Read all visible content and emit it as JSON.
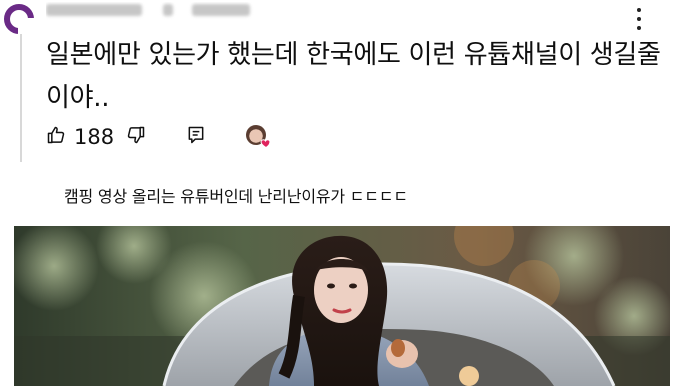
{
  "comment": {
    "text": "일본에만 있는가 했는데 한국에도 이런 유튭채널이 생길줄이야..",
    "like_count": "188"
  },
  "icons": {
    "avatar": "channel-avatar",
    "more": "more-vert-icon",
    "like": "thumb-up-icon",
    "dislike": "thumb-down-icon",
    "reply": "reply-icon",
    "creator_heart": "creator-heart-avatar"
  },
  "caption": {
    "text": "캠핑 영상 올리는 유튜버인데 난리난이유가 ㄷㄷㄷㄷ"
  },
  "colors": {
    "avatar_ring": "#6a2a86",
    "heart": "#e0245e"
  }
}
